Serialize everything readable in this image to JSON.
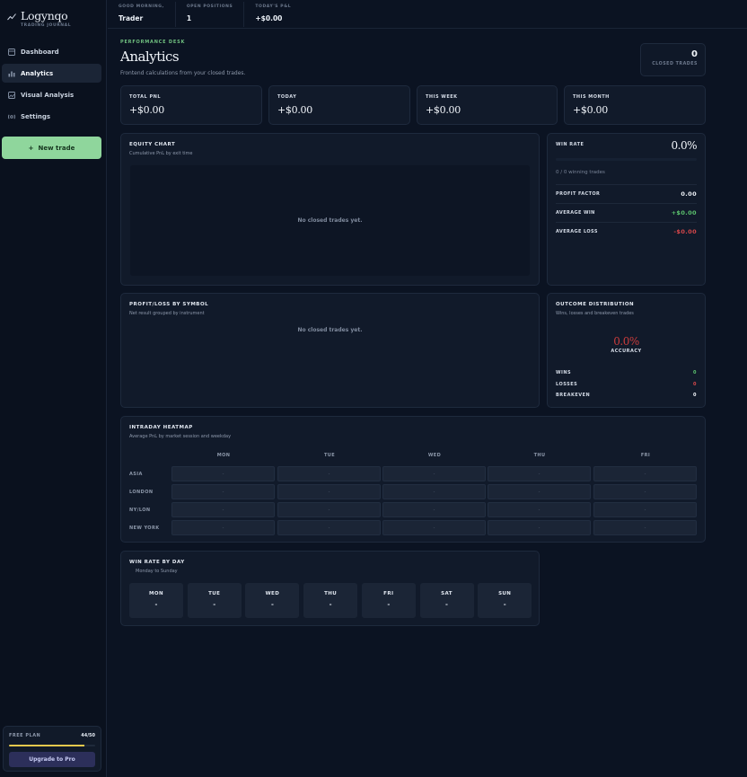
{
  "app": {
    "name": "Logynqo",
    "tagline": "TRADING JOURNAL"
  },
  "sidebar": {
    "items": [
      {
        "label": "Dashboard",
        "icon": "dashboard-icon",
        "active": false
      },
      {
        "label": "Analytics",
        "icon": "bar-chart-icon",
        "active": true
      },
      {
        "label": "Visual Analysis",
        "icon": "image-icon",
        "active": false
      },
      {
        "label": "Settings",
        "icon": "gear-icon",
        "active": false
      }
    ],
    "new_trade_label": "New trade",
    "plan": {
      "label": "FREE PLAN",
      "count": "44/50",
      "progress_fraction": 0.88,
      "upgrade_label": "Upgrade to Pro"
    }
  },
  "topbar": {
    "greeting_label": "GOOD MORNING,",
    "greeting_value": "Trader",
    "open_positions_label": "OPEN POSITIONS",
    "open_positions_value": "1",
    "todays_pnl_label": "TODAY'S P&L",
    "todays_pnl_value": "+$0.00"
  },
  "header": {
    "eyebrow": "PERFORMANCE DESK",
    "title": "Analytics",
    "subtitle": "Frontend calculations from your closed trades.",
    "closed_trades_value": "0",
    "closed_trades_label": "CLOSED TRADES"
  },
  "stats": [
    {
      "label": "TOTAL PNL",
      "value": "+$0.00"
    },
    {
      "label": "TODAY",
      "value": "+$0.00"
    },
    {
      "label": "THIS WEEK",
      "value": "+$0.00"
    },
    {
      "label": "THIS MONTH",
      "value": "+$0.00"
    }
  ],
  "equity": {
    "title": "EQUITY CHART",
    "subtitle": "Cumulative PnL by exit time",
    "empty": "No closed trades yet."
  },
  "win_rate": {
    "label": "WIN RATE",
    "value": "0.0%",
    "fraction": 0,
    "note": "0 / 0 winning trades",
    "metrics": [
      {
        "label": "PROFIT FACTOR",
        "value": "0.00",
        "color": "#f1f5fa"
      },
      {
        "label": "AVERAGE WIN",
        "value": "+$0.00",
        "color": "#5cc46e"
      },
      {
        "label": "AVERAGE LOSS",
        "value": "-$0.00",
        "color": "#d8474a"
      }
    ]
  },
  "symbol": {
    "title": "PROFIT/LOSS BY SYMBOL",
    "subtitle": "Net result grouped by instrument",
    "empty": "No closed trades yet."
  },
  "outcome": {
    "title": "OUTCOME DISTRIBUTION",
    "subtitle": "Wins, losses and breakeven trades",
    "accuracy_value": "0.0%",
    "accuracy_label": "ACCURACY",
    "rows": [
      {
        "label": "WINS",
        "value": "0",
        "color": "#5cc46e"
      },
      {
        "label": "LOSSES",
        "value": "0",
        "color": "#d8474a"
      },
      {
        "label": "BREAKEVEN",
        "value": "0",
        "color": "#f1f5fa"
      }
    ]
  },
  "heatmap": {
    "title": "INTRADAY HEATMAP",
    "subtitle": "Average PnL by market session and weekday",
    "columns": [
      "MON",
      "TUE",
      "WED",
      "THU",
      "FRI"
    ],
    "rows": [
      "ASIA",
      "LONDON",
      "NY/LON",
      "NEW YORK"
    ],
    "cell_value": "-"
  },
  "by_day": {
    "title": "WIN RATE BY DAY",
    "subtitle": "Monday to Sunday",
    "days": [
      {
        "name": "MON",
        "value": "-"
      },
      {
        "name": "TUE",
        "value": "-"
      },
      {
        "name": "WED",
        "value": "-"
      },
      {
        "name": "THU",
        "value": "-"
      },
      {
        "name": "FRI",
        "value": "-"
      },
      {
        "name": "SAT",
        "value": "-"
      },
      {
        "name": "SUN",
        "value": "-"
      }
    ]
  }
}
